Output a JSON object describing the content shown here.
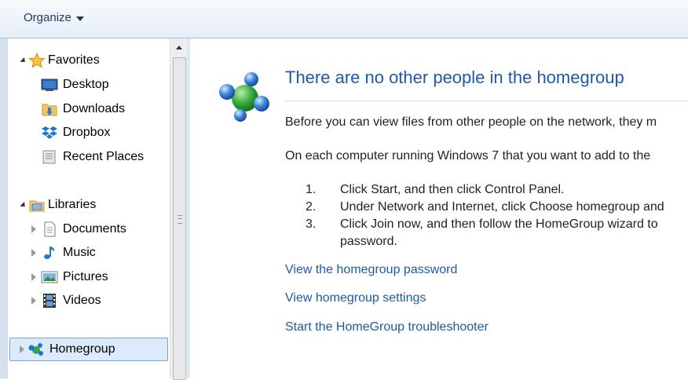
{
  "toolbar": {
    "organize_label": "Organize"
  },
  "nav": {
    "favorites": {
      "label": "Favorites",
      "items": [
        {
          "label": "Desktop",
          "icon": "desktop-icon"
        },
        {
          "label": "Downloads",
          "icon": "downloads-folder-icon"
        },
        {
          "label": "Dropbox",
          "icon": "dropbox-icon"
        },
        {
          "label": "Recent Places",
          "icon": "recent-places-icon"
        }
      ]
    },
    "libraries": {
      "label": "Libraries",
      "items": [
        {
          "label": "Documents",
          "icon": "documents-icon"
        },
        {
          "label": "Music",
          "icon": "music-icon"
        },
        {
          "label": "Pictures",
          "icon": "pictures-icon"
        },
        {
          "label": "Videos",
          "icon": "videos-icon"
        }
      ]
    },
    "homegroup": {
      "label": "Homegroup",
      "selected": true
    }
  },
  "content": {
    "title": "There are no other people in the homegroup",
    "para1": "Before you can view files from other people on the network, they m",
    "para2": "On each computer running Windows 7 that you want to add to the",
    "steps": [
      {
        "num": "1.",
        "text": "Click Start, and then click Control Panel."
      },
      {
        "num": "2.",
        "text": "Under Network and Internet, click Choose homegroup and"
      },
      {
        "num": "3.",
        "text": "Click Join now, and then follow the HomeGroup wizard to",
        "text2": "password."
      }
    ],
    "links": {
      "view_password": "View the homegroup password",
      "view_settings": "View homegroup settings",
      "troubleshooter": "Start the HomeGroup troubleshooter"
    }
  },
  "colors": {
    "link": "#1e5aa0",
    "title": "#1e5aa0",
    "selection": "#dcebfc"
  }
}
